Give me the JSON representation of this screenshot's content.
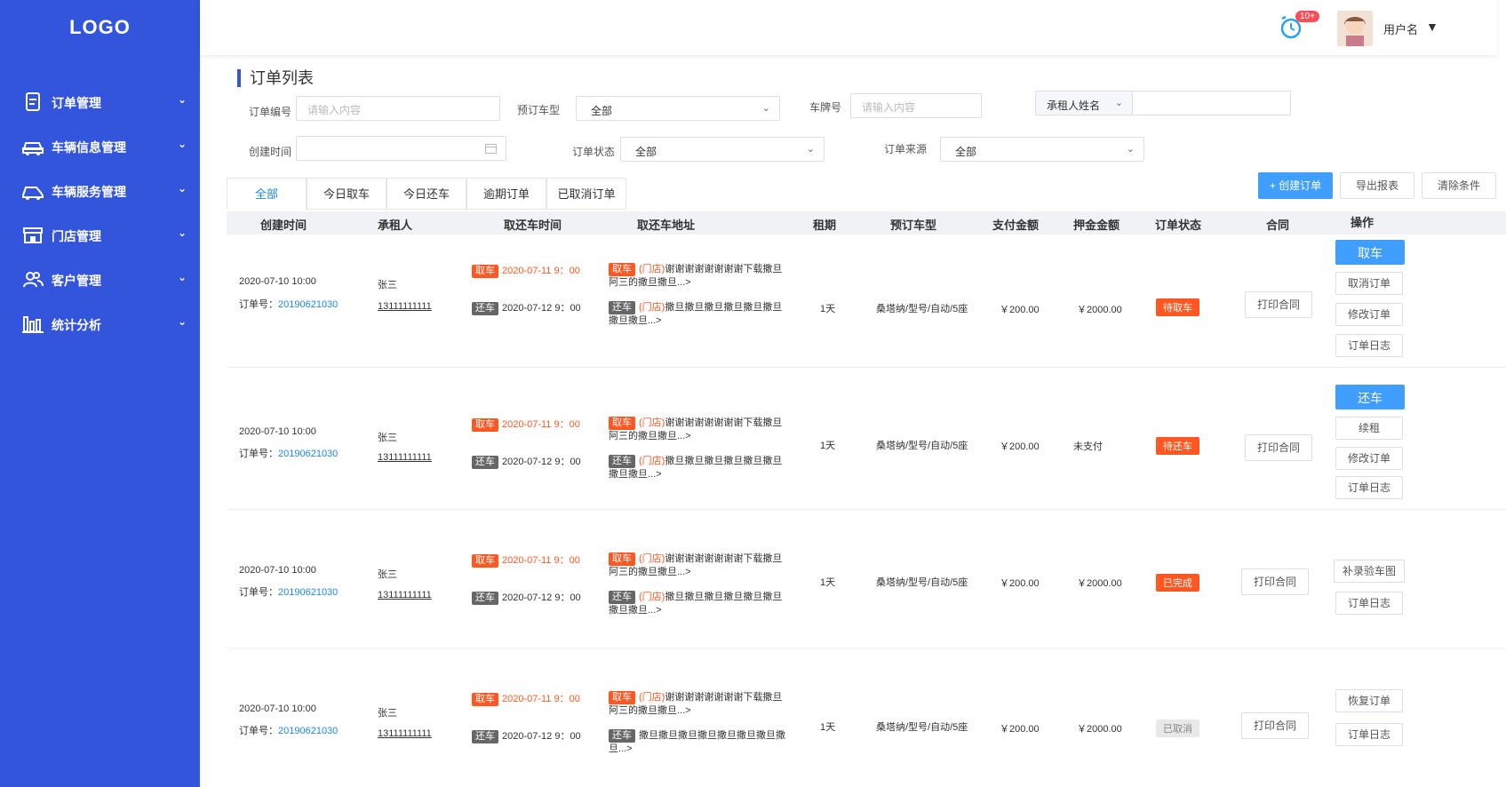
{
  "sidebar": {
    "logo": "LOGO",
    "items": [
      {
        "label": "订单管理",
        "icon": "document-icon"
      },
      {
        "label": "车辆信息管理",
        "icon": "car-icon"
      },
      {
        "label": "车辆服务管理",
        "icon": "car-service-icon"
      },
      {
        "label": "门店管理",
        "icon": "store-icon"
      },
      {
        "label": "客户管理",
        "icon": "users-icon"
      },
      {
        "label": "统计分析",
        "icon": "bar-chart-icon"
      }
    ]
  },
  "header": {
    "badge": "10+",
    "username": "用户名"
  },
  "page": {
    "title": "订单列表"
  },
  "filters": {
    "order_no_label": "订单编号",
    "order_no_placeholder": "请输入内容",
    "car_type_label": "预订车型",
    "car_type_value": "全部",
    "plate_label": "车牌号",
    "plate_placeholder": "请输入内容",
    "renter_select": "承租人姓名",
    "created_label": "创建时间",
    "status_label": "订单状态",
    "status_value": "全部",
    "source_label": "订单来源",
    "source_value": "全部"
  },
  "tabs": [
    "全部",
    "今日取车",
    "今日还车",
    "逾期订单",
    "已取消订单"
  ],
  "actions": {
    "create": "+ 创建订单",
    "export": "导出报表",
    "clear": "清除条件"
  },
  "columns": [
    "创建时间",
    "承租人",
    "取还车时间",
    "取还车地址",
    "租期",
    "预订车型",
    "支付金额",
    "押金金额",
    "订单状态",
    "合同",
    "操作"
  ],
  "labels": {
    "pick": "取车",
    "ret": "还车",
    "store": "(门店)",
    "order_prefix": "订单号：",
    "print": "打印合同"
  },
  "rows": [
    {
      "created": "2020-07-10 10:00",
      "order_no": "20190621030",
      "renter": "张三",
      "phone": "13111111111",
      "pick_time": "2020-07-11 9：00",
      "ret_time": "2020-07-12 9：00",
      "pick_addr": "谢谢谢谢谢谢谢谢下载撒旦阿三的撒旦撒旦...>",
      "ret_addr": "撒旦撒旦撒旦撒旦撒旦撒旦撒旦撒旦...>",
      "period": "1天",
      "car": "桑塔纳/型号/自动/5座",
      "paid": "￥200.00",
      "deposit": "￥2000.00",
      "status": "待取车",
      "status_color": "#ff5722",
      "ops": [
        "取消订单",
        "修改订单",
        "订单日志"
      ],
      "primary_op": "取车"
    },
    {
      "created": "2020-07-10 10:00",
      "order_no": "20190621030",
      "renter": "张三",
      "phone": "13111111111",
      "pick_time": "2020-07-11 9：00",
      "ret_time": "2020-07-12 9：00",
      "pick_addr": "谢谢谢谢谢谢谢谢下载撒旦阿三的撒旦撒旦...>",
      "ret_addr": "撒旦撒旦撒旦撒旦撒旦撒旦撒旦撒旦...>",
      "period": "1天",
      "car": "桑塔纳/型号/自动/5座",
      "paid": "￥200.00",
      "deposit": "未支付",
      "status": "待还车",
      "status_color": "#ff5722",
      "ops": [
        "续租",
        "修改订单",
        "订单日志"
      ],
      "primary_op": "还车"
    },
    {
      "created": "2020-07-10 10:00",
      "order_no": "20190621030",
      "renter": "张三",
      "phone": "13111111111",
      "pick_time": "2020-07-11 9：00",
      "ret_time": "2020-07-12 9：00",
      "pick_addr": "谢谢谢谢谢谢谢谢下载撒旦阿三的撒旦撒旦...>",
      "ret_addr": "撒旦撒旦撒旦撒旦撒旦撒旦撒旦撒旦...>",
      "period": "1天",
      "car": "桑塔纳/型号/自动/5座",
      "paid": "￥200.00",
      "deposit": "￥2000.00",
      "status": "已完成",
      "status_color": "#ff5722",
      "ops": [
        "补录验车图",
        "订单日志"
      ],
      "primary_op": ""
    },
    {
      "created": "2020-07-10 10:00",
      "order_no": "20190621030",
      "renter": "张三",
      "phone": "13111111111",
      "pick_time": "2020-07-11 9：00",
      "ret_time": "2020-07-12 9：00",
      "pick_addr": "谢谢谢谢谢谢谢谢下载撒旦阿三的撒旦撒旦...>",
      "ret_addr": "撒旦撒旦撒旦撒旦撒旦撒旦撒旦撒旦...>",
      "period": "1天",
      "car": "桑塔纳/型号/自动/5座",
      "paid": "￥200.00",
      "deposit": "￥2000.00",
      "status": "已取消",
      "status_color": "#e8e8e8",
      "ops": [
        "恢复订单",
        "订单日志"
      ],
      "primary_op": ""
    }
  ]
}
